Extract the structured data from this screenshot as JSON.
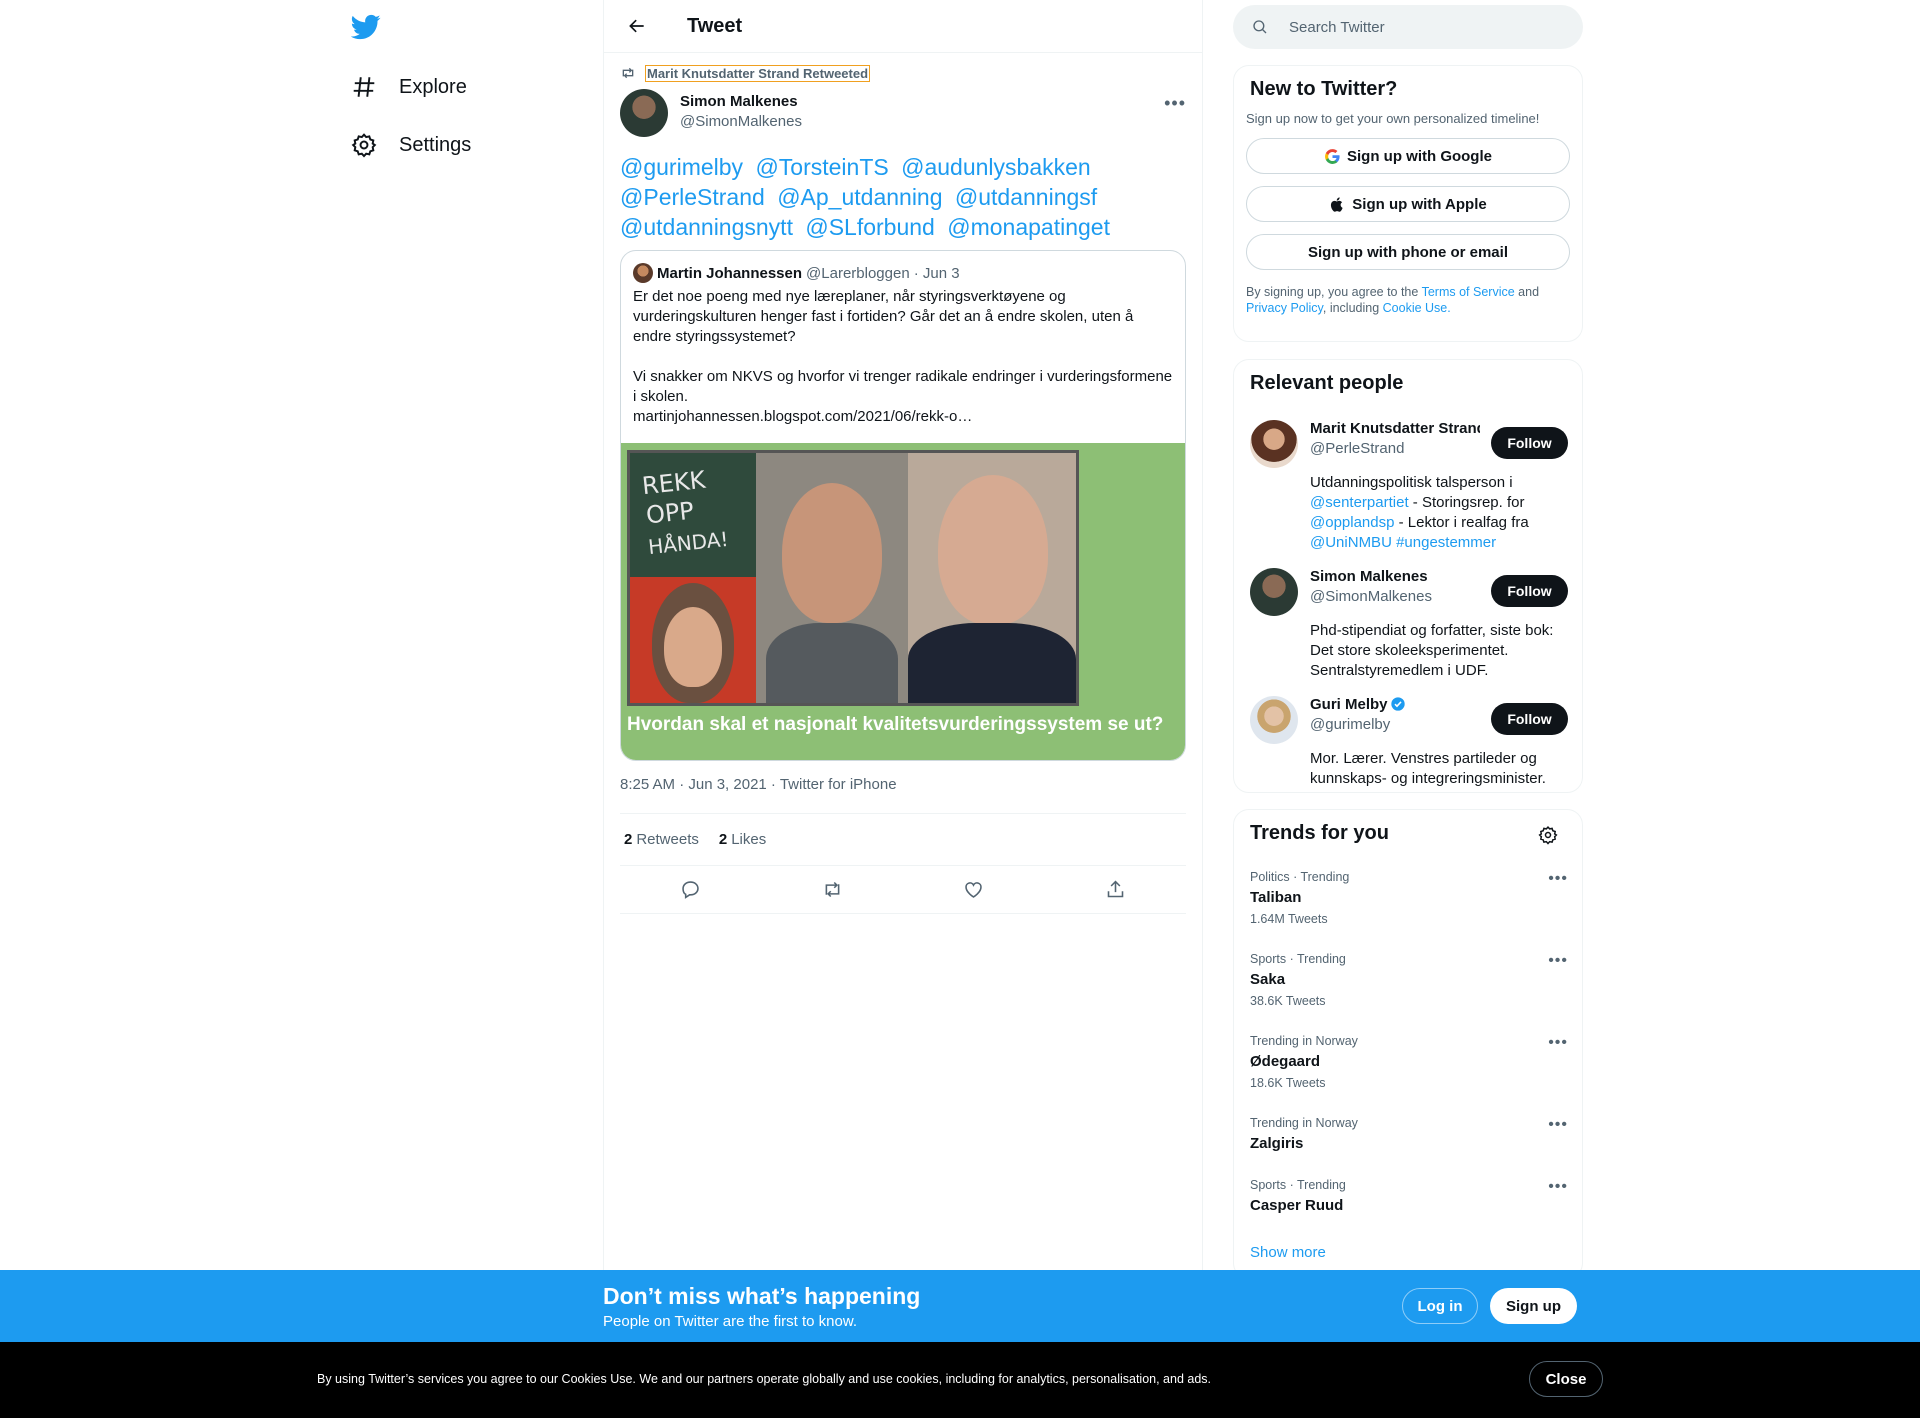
{
  "nav": {
    "explore_label": "Explore",
    "settings_label": "Settings"
  },
  "header": {
    "title": "Tweet"
  },
  "tweet": {
    "retweeted_by": "Marit Knutsdatter Strand Retweeted",
    "author_name": "Simon Malkenes",
    "author_handle": "@SimonMalkenes",
    "mentions": [
      "@gurimelby",
      "@TorsteinTS",
      "@audunlysbakken",
      "@PerleStrand",
      "@Ap_utdanning",
      "@utdanningsf",
      "@utdanningsnytt",
      "@SLforbund",
      "@monapatinget"
    ],
    "quote": {
      "author_name": "Martin Johannessen",
      "author_handle": "@Larerbloggen",
      "date": "· Jun 3",
      "text1": "Er det noe poeng med nye læreplaner, når styringsverktøyene og vurderingskulturen henger fast i fortiden? Går det an å endre skolen, uten å endre styringssystemet?",
      "text2": "Vi snakker om NKVS og hvorfor vi trenger radikale endringer i vurderingsformene i skolen.",
      "link": "martinjohannessen.blogspot.com/2021/06/rekk-o…",
      "board_text": [
        "REKK",
        "OPP",
        "HÅNDA!"
      ],
      "image_caption": "Hvordan skal et nasjonalt kvalitetsvurderingssystem se ut?"
    },
    "time": "8:25 AM · Jun 3, 2021 · ",
    "source": "Twitter for iPhone",
    "retweets_count": "2",
    "retweets_label": "Retweets",
    "likes_count": "2",
    "likes_label": "Likes"
  },
  "search": {
    "placeholder": "Search Twitter"
  },
  "new_to_twitter": {
    "title": "New to Twitter?",
    "subtitle": "Sign up now to get your own personalized timeline!",
    "google_label": "Sign up with Google",
    "apple_label": "Sign up with Apple",
    "phone_label": "Sign up with phone or email",
    "terms_prefix": "By signing up, you agree to the ",
    "terms_link": "Terms of Service",
    "terms_and": " and ",
    "privacy_link": "Privacy Policy",
    "terms_including": ", including ",
    "cookie_link": "Cookie Use."
  },
  "relevant_people": {
    "title": "Relevant people",
    "follow_label": "Follow",
    "people": [
      {
        "name": "Marit Knutsdatter Strand",
        "handle": "@PerleStrand",
        "bio_1": "Utdanningspolitisk talsperson i ",
        "bio_link_1": "@senterpartiet",
        "bio_2": " - Storingsrep. for ",
        "bio_link_2": "@opplandsp",
        "bio_3": " - Lektor i realfag fra ",
        "bio_link_3": "@UniNMBU",
        "bio_link_4": "#ungestemmer"
      },
      {
        "name": "Simon Malkenes",
        "handle": "@SimonMalkenes",
        "bio": "Phd-stipendiat og forfatter, siste bok: Det store skoleeksperimentet. Sentralstyremedlem i UDF."
      },
      {
        "name": "Guri Melby",
        "handle": "@gurimelby",
        "bio": "Mor. Lærer. Venstres partileder og kunnskaps- og integreringsminister."
      }
    ]
  },
  "trends": {
    "title": "Trends for you",
    "items": [
      {
        "meta": "Politics · Trending",
        "name": "Taliban",
        "count": "1.64M Tweets"
      },
      {
        "meta": "Sports · Trending",
        "name": "Saka",
        "count": "38.6K Tweets"
      },
      {
        "meta": "Trending in Norway",
        "name": "Ødegaard",
        "count": "18.6K Tweets"
      },
      {
        "meta": "Trending in Norway",
        "name": "Zalgiris",
        "count": ""
      },
      {
        "meta": "Sports · Trending",
        "name": "Casper Ruud",
        "count": ""
      }
    ],
    "show_more": "Show more"
  },
  "banner": {
    "title": "Don’t miss what’s happening",
    "subtitle": "People on Twitter are the first to know.",
    "login_label": "Log in",
    "signup_label": "Sign up"
  },
  "cookies": {
    "text": "By using Twitter’s services you agree to our Cookies Use. We and our partners operate globally and use cookies, including for analytics, personalisation, and ads.",
    "close_label": "Close"
  },
  "colors": {
    "accent": "#1d9bf0",
    "text": "#0f1419",
    "muted": "#536471",
    "image_bg": "#8dbf75"
  }
}
